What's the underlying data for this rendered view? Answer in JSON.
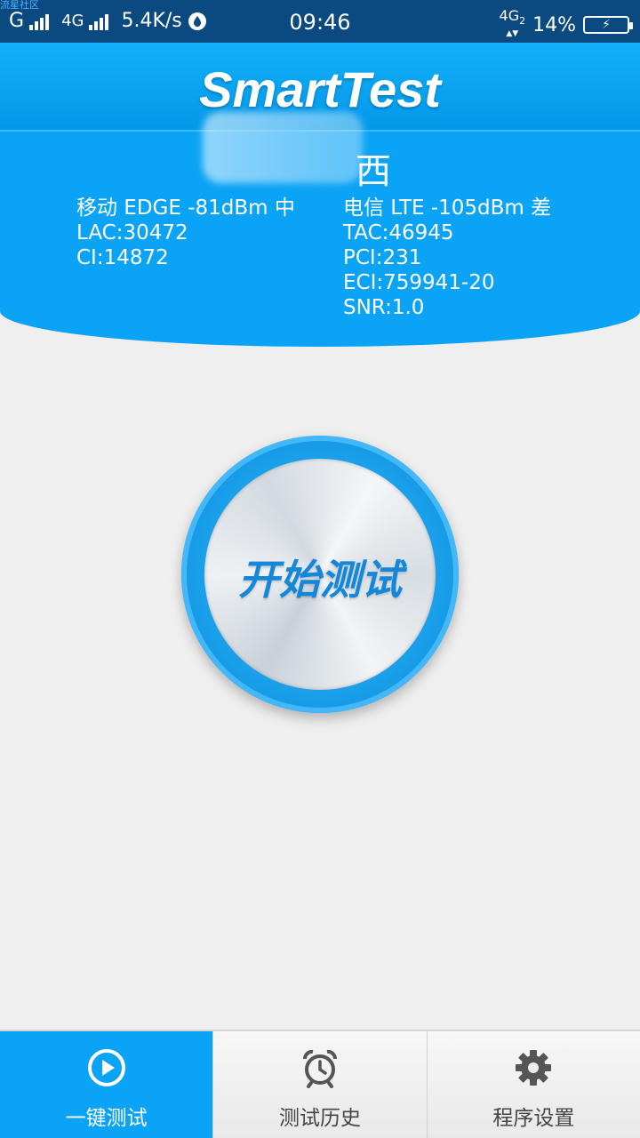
{
  "status_bar": {
    "watermark": "流星社区",
    "carrier1": "G",
    "carrier2": "4G",
    "speed": "5.4K/s",
    "time": "09:46",
    "network_badge": "4G",
    "network_sub": "2",
    "battery_percent": "14%"
  },
  "header": {
    "app_title": "SmartTest",
    "region": "西",
    "left_info": {
      "line1": "移动 EDGE -81dBm 中",
      "line2": "LAC:30472",
      "line3": "CI:14872"
    },
    "right_info": {
      "line1": "电信 LTE -105dBm 差",
      "line2": "TAC:46945",
      "line3": "PCI:231",
      "line4": "ECI:759941-20",
      "line5": "SNR:1.0"
    }
  },
  "main": {
    "start_button_label": "开始测试"
  },
  "bottom_nav": {
    "tabs": [
      {
        "label": "一键测试",
        "icon": "play-circle-icon",
        "active": true
      },
      {
        "label": "测试历史",
        "icon": "alarm-clock-icon",
        "active": false
      },
      {
        "label": "程序设置",
        "icon": "gear-icon",
        "active": false
      }
    ]
  },
  "colors": {
    "primary": "#0aa3f5",
    "status_bar": "#0a4a80",
    "background": "#efefef"
  }
}
